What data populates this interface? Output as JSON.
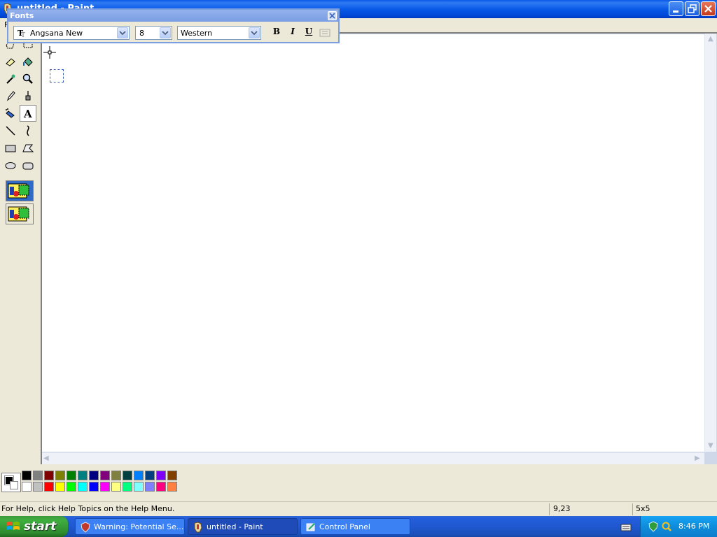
{
  "window": {
    "title": "untitled - Paint",
    "menu_first": "F"
  },
  "fonts_toolbar": {
    "title": "Fonts",
    "font_name": "Angsana New",
    "font_size": "8",
    "script": "Western",
    "bold_label": "B",
    "italic_label": "I",
    "underline_label": "U",
    "font_type_icon": "truetype-icon"
  },
  "toolbox": {
    "tools": [
      "free-form-select",
      "select",
      "eraser",
      "fill-with-color",
      "pick-color",
      "magnifier",
      "pencil",
      "brush",
      "airbrush",
      "text",
      "line",
      "curve",
      "rectangle",
      "polygon",
      "ellipse",
      "rounded-rectangle"
    ],
    "active_tool": "text"
  },
  "palette": {
    "foreground": "#000000",
    "background": "#ffffff",
    "row1": [
      "#000000",
      "#808080",
      "#800000",
      "#808000",
      "#008000",
      "#008080",
      "#000080",
      "#800080",
      "#808040",
      "#004040",
      "#0080ff",
      "#004080",
      "#8000ff",
      "#804000"
    ],
    "row2": [
      "#ffffff",
      "#c0c0c0",
      "#ff0000",
      "#ffff00",
      "#00ff00",
      "#00ffff",
      "#0000ff",
      "#ff00ff",
      "#ffff80",
      "#00ff80",
      "#80ffff",
      "#8080ff",
      "#ff0080",
      "#ff8040"
    ]
  },
  "statusbar": {
    "help_text": "For Help, click Help Topics on the Help Menu.",
    "coordinates": "9,23",
    "selection_size": "5x5"
  },
  "taskbar": {
    "start_label": "start",
    "tasks": [
      {
        "label": "Warning: Potential Se...",
        "active": false
      },
      {
        "label": "untitled - Paint",
        "active": true
      },
      {
        "label": "Control Panel",
        "active": false
      }
    ],
    "clock": "8:46 PM"
  }
}
